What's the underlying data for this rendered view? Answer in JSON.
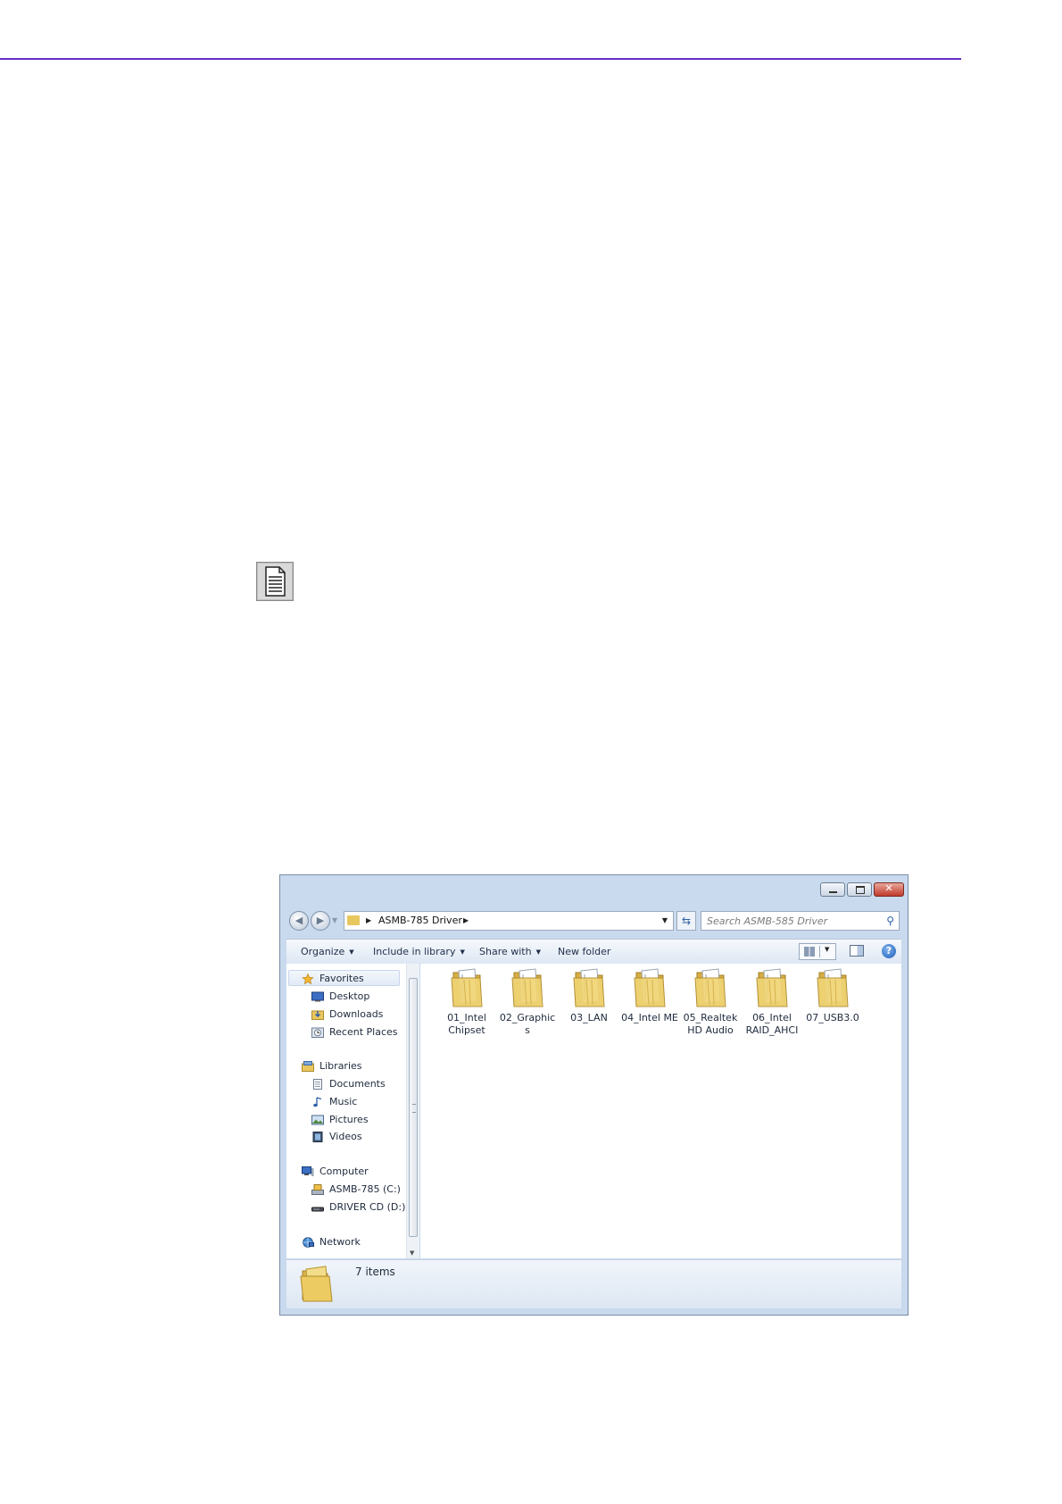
{
  "window": {
    "address_path": "ASMB-785 Driver",
    "search_placeholder": "Search ASMB-585 Driver"
  },
  "toolbar": {
    "organize": "Organize",
    "include_in_library": "Include in library",
    "share_with": "Share with",
    "new_folder": "New folder"
  },
  "nav_pane": {
    "favorites": "Favorites",
    "desktop": "Desktop",
    "downloads": "Downloads",
    "recent_places": "Recent Places",
    "libraries": "Libraries",
    "documents": "Documents",
    "music": "Music",
    "pictures": "Pictures",
    "videos": "Videos",
    "computer": "Computer",
    "drive_c": "ASMB-785 (C:)",
    "drive_d": "DRIVER CD (D:)",
    "network": "Network"
  },
  "files": [
    {
      "line1": "01_Intel",
      "line2": "Chipset"
    },
    {
      "line1": "02_Graphic",
      "line2": "s"
    },
    {
      "line1": "03_LAN",
      "line2": ""
    },
    {
      "line1": "04_Intel ME",
      "line2": ""
    },
    {
      "line1": "05_Realtek",
      "line2": "HD Audio"
    },
    {
      "line1": "06_Intel",
      "line2": "RAID_AHCI"
    },
    {
      "line1": "07_USB3.0",
      "line2": ""
    }
  ],
  "status": {
    "item_count": "7 items"
  },
  "colors": {
    "rule": "#6a2fc2",
    "folder": "#e9c75f"
  },
  "icons": [
    "note-icon",
    "folder-icon",
    "star-icon",
    "search-icon",
    "help-icon"
  ]
}
